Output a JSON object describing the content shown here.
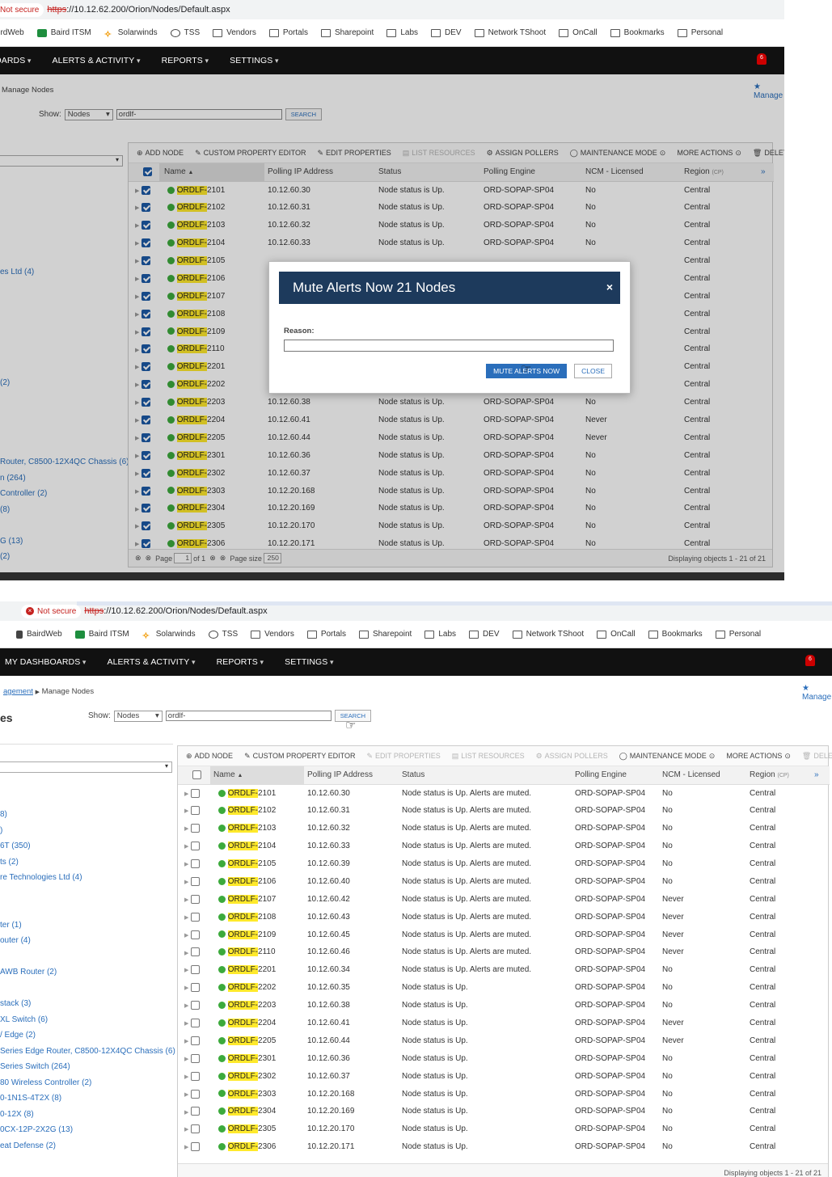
{
  "browser": {
    "not_secure_label": "Not secure",
    "url_scheme": "https",
    "url_rest": "://10.12.62.200/Orion/Nodes/Default.aspx",
    "bookmarks": [
      "BairdWeb",
      "Baird ITSM",
      "Solarwinds",
      "TSS",
      "Vendors",
      "Portals",
      "Sharepoint",
      "Labs",
      "DEV",
      "Network TShoot",
      "OnCall",
      "Bookmarks",
      "Personal"
    ]
  },
  "nav": {
    "items": [
      "MY DASHBOARDS",
      "ALERTS & ACTIVITY",
      "REPORTS",
      "SETTINGS"
    ],
    "bell_count": "6"
  },
  "breadcrumb": {
    "parent": "agement",
    "current": "Manage Nodes"
  },
  "favorite_label": "Manage",
  "page_title_fragment": "es",
  "filter": {
    "show_label": "Show:",
    "show_value": "Nodes",
    "search_value": "ordlf-",
    "search_button": "SEARCH"
  },
  "toolbar": {
    "add_node": "ADD NODE",
    "custom_property_editor": "CUSTOM PROPERTY EDITOR",
    "edit_properties": "EDIT PROPERTIES",
    "list_resources": "LIST RESOURCES",
    "assign_pollers": "ASSIGN POLLERS",
    "maintenance_mode": "MAINTENANCE MODE",
    "more_actions": "MORE ACTIONS",
    "delete": "DELETE"
  },
  "columns": {
    "name": "Name",
    "ip": "Polling IP Address",
    "status": "Status",
    "engine": "Polling Engine",
    "ncm": "NCM - Licensed",
    "region": "Region",
    "region_suffix": "(CP)"
  },
  "name_prefix": "ORDLF-",
  "shot1": {
    "left_groups": [
      {
        "label": "es Ltd (4)"
      },
      {
        "label": "(2)"
      },
      {
        "label": "Router, C8500-12X4QC Chassis (6)"
      },
      {
        "label": "n (264)"
      },
      {
        "label": "Controller (2)"
      },
      {
        "label": "(8)"
      },
      {
        "label": "G (13)"
      },
      {
        "label": "(2)"
      }
    ],
    "rows": [
      {
        "num": "2101",
        "ip": "10.12.60.30",
        "status": "Node status is Up.",
        "engine": "ORD-SOPAP-SP04",
        "ncm": "No",
        "region": "Central"
      },
      {
        "num": "2102",
        "ip": "10.12.60.31",
        "status": "Node status is Up.",
        "engine": "ORD-SOPAP-SP04",
        "ncm": "No",
        "region": "Central"
      },
      {
        "num": "2103",
        "ip": "10.12.60.32",
        "status": "Node status is Up.",
        "engine": "ORD-SOPAP-SP04",
        "ncm": "No",
        "region": "Central"
      },
      {
        "num": "2104",
        "ip": "10.12.60.33",
        "status": "Node status is Up.",
        "engine": "ORD-SOPAP-SP04",
        "ncm": "No",
        "region": "Central"
      },
      {
        "num": "2105",
        "ip": "",
        "status": "",
        "engine": "",
        "ncm": "",
        "region": "Central"
      },
      {
        "num": "2106",
        "ip": "",
        "status": "",
        "engine": "",
        "ncm": "",
        "region": "Central"
      },
      {
        "num": "2107",
        "ip": "",
        "status": "",
        "engine": "",
        "ncm": "",
        "region": "Central"
      },
      {
        "num": "2108",
        "ip": "",
        "status": "",
        "engine": "",
        "ncm": "",
        "region": "Central"
      },
      {
        "num": "2109",
        "ip": "",
        "status": "",
        "engine": "",
        "ncm": "",
        "region": "Central"
      },
      {
        "num": "2110",
        "ip": "",
        "status": "",
        "engine": "",
        "ncm": "",
        "region": "Central"
      },
      {
        "num": "2201",
        "ip": "",
        "status": "",
        "engine": "",
        "ncm": "",
        "region": "Central"
      },
      {
        "num": "2202",
        "ip": "",
        "status": "",
        "engine": "",
        "ncm": "",
        "region": "Central"
      },
      {
        "num": "2203",
        "ip": "10.12.60.38",
        "status": "Node status is Up.",
        "engine": "ORD-SOPAP-SP04",
        "ncm": "No",
        "region": "Central"
      },
      {
        "num": "2204",
        "ip": "10.12.60.41",
        "status": "Node status is Up.",
        "engine": "ORD-SOPAP-SP04",
        "ncm": "Never",
        "region": "Central"
      },
      {
        "num": "2205",
        "ip": "10.12.60.44",
        "status": "Node status is Up.",
        "engine": "ORD-SOPAP-SP04",
        "ncm": "Never",
        "region": "Central"
      },
      {
        "num": "2301",
        "ip": "10.12.60.36",
        "status": "Node status is Up.",
        "engine": "ORD-SOPAP-SP04",
        "ncm": "No",
        "region": "Central"
      },
      {
        "num": "2302",
        "ip": "10.12.60.37",
        "status": "Node status is Up.",
        "engine": "ORD-SOPAP-SP04",
        "ncm": "No",
        "region": "Central"
      },
      {
        "num": "2303",
        "ip": "10.12.20.168",
        "status": "Node status is Up.",
        "engine": "ORD-SOPAP-SP04",
        "ncm": "No",
        "region": "Central"
      },
      {
        "num": "2304",
        "ip": "10.12.20.169",
        "status": "Node status is Up.",
        "engine": "ORD-SOPAP-SP04",
        "ncm": "No",
        "region": "Central"
      },
      {
        "num": "2305",
        "ip": "10.12.20.170",
        "status": "Node status is Up.",
        "engine": "ORD-SOPAP-SP04",
        "ncm": "No",
        "region": "Central"
      },
      {
        "num": "2306",
        "ip": "10.12.20.171",
        "status": "Node status is Up.",
        "engine": "ORD-SOPAP-SP04",
        "ncm": "No",
        "region": "Central"
      }
    ],
    "pager": {
      "page_label": "Page",
      "page_value": "1",
      "of_label": "of 1",
      "size_label": "Page size",
      "size_value": "250",
      "display_text": "Displaying objects 1 - 21 of 21"
    }
  },
  "dialog": {
    "title": "Mute Alerts Now 21 Nodes",
    "close_x": "×",
    "reason_label": "Reason:",
    "reason_value": "",
    "mute_button": "MUTE ALERTS NOW",
    "close_button": "CLOSE"
  },
  "shot2": {
    "left_groups": [
      {
        "label": "8)"
      },
      {
        "label": ")"
      },
      {
        "label": "6T (350)"
      },
      {
        "label": "ts (2)"
      },
      {
        "label": "re Technologies Ltd (4)"
      },
      {
        "label": "ter (1)"
      },
      {
        "label": "outer (4)"
      },
      {
        "label": "AWB Router (2)"
      },
      {
        "label": "stack (3)"
      },
      {
        "label": "XL Switch (6)"
      },
      {
        "label": "/ Edge (2)"
      },
      {
        "label": "Series Edge Router, C8500-12X4QC Chassis (6)"
      },
      {
        "label": "Series Switch (264)"
      },
      {
        "label": "80 Wireless Controller (2)"
      },
      {
        "label": "0-1N1S-4T2X (8)"
      },
      {
        "label": "0-12X (8)"
      },
      {
        "label": "0CX-12P-2X2G (13)"
      },
      {
        "label": "eat Defense (2)"
      }
    ],
    "rows": [
      {
        "num": "2101",
        "ip": "10.12.60.30",
        "status": "Node status is Up. Alerts are muted.",
        "engine": "ORD-SOPAP-SP04",
        "ncm": "No",
        "region": "Central"
      },
      {
        "num": "2102",
        "ip": "10.12.60.31",
        "status": "Node status is Up. Alerts are muted.",
        "engine": "ORD-SOPAP-SP04",
        "ncm": "No",
        "region": "Central"
      },
      {
        "num": "2103",
        "ip": "10.12.60.32",
        "status": "Node status is Up. Alerts are muted.",
        "engine": "ORD-SOPAP-SP04",
        "ncm": "No",
        "region": "Central"
      },
      {
        "num": "2104",
        "ip": "10.12.60.33",
        "status": "Node status is Up. Alerts are muted.",
        "engine": "ORD-SOPAP-SP04",
        "ncm": "No",
        "region": "Central"
      },
      {
        "num": "2105",
        "ip": "10.12.60.39",
        "status": "Node status is Up. Alerts are muted.",
        "engine": "ORD-SOPAP-SP04",
        "ncm": "No",
        "region": "Central"
      },
      {
        "num": "2106",
        "ip": "10.12.60.40",
        "status": "Node status is Up. Alerts are muted.",
        "engine": "ORD-SOPAP-SP04",
        "ncm": "No",
        "region": "Central"
      },
      {
        "num": "2107",
        "ip": "10.12.60.42",
        "status": "Node status is Up. Alerts are muted.",
        "engine": "ORD-SOPAP-SP04",
        "ncm": "Never",
        "region": "Central"
      },
      {
        "num": "2108",
        "ip": "10.12.60.43",
        "status": "Node status is Up. Alerts are muted.",
        "engine": "ORD-SOPAP-SP04",
        "ncm": "Never",
        "region": "Central"
      },
      {
        "num": "2109",
        "ip": "10.12.60.45",
        "status": "Node status is Up. Alerts are muted.",
        "engine": "ORD-SOPAP-SP04",
        "ncm": "Never",
        "region": "Central"
      },
      {
        "num": "2110",
        "ip": "10.12.60.46",
        "status": "Node status is Up. Alerts are muted.",
        "engine": "ORD-SOPAP-SP04",
        "ncm": "Never",
        "region": "Central"
      },
      {
        "num": "2201",
        "ip": "10.12.60.34",
        "status": "Node status is Up. Alerts are muted.",
        "engine": "ORD-SOPAP-SP04",
        "ncm": "No",
        "region": "Central"
      },
      {
        "num": "2202",
        "ip": "10.12.60.35",
        "status": "Node status is Up.",
        "engine": "ORD-SOPAP-SP04",
        "ncm": "No",
        "region": "Central"
      },
      {
        "num": "2203",
        "ip": "10.12.60.38",
        "status": "Node status is Up.",
        "engine": "ORD-SOPAP-SP04",
        "ncm": "No",
        "region": "Central"
      },
      {
        "num": "2204",
        "ip": "10.12.60.41",
        "status": "Node status is Up.",
        "engine": "ORD-SOPAP-SP04",
        "ncm": "Never",
        "region": "Central"
      },
      {
        "num": "2205",
        "ip": "10.12.60.44",
        "status": "Node status is Up.",
        "engine": "ORD-SOPAP-SP04",
        "ncm": "Never",
        "region": "Central"
      },
      {
        "num": "2301",
        "ip": "10.12.60.36",
        "status": "Node status is Up.",
        "engine": "ORD-SOPAP-SP04",
        "ncm": "No",
        "region": "Central"
      },
      {
        "num": "2302",
        "ip": "10.12.60.37",
        "status": "Node status is Up.",
        "engine": "ORD-SOPAP-SP04",
        "ncm": "No",
        "region": "Central"
      },
      {
        "num": "2303",
        "ip": "10.12.20.168",
        "status": "Node status is Up.",
        "engine": "ORD-SOPAP-SP04",
        "ncm": "No",
        "region": "Central"
      },
      {
        "num": "2304",
        "ip": "10.12.20.169",
        "status": "Node status is Up.",
        "engine": "ORD-SOPAP-SP04",
        "ncm": "No",
        "region": "Central"
      },
      {
        "num": "2305",
        "ip": "10.12.20.170",
        "status": "Node status is Up.",
        "engine": "ORD-SOPAP-SP04",
        "ncm": "No",
        "region": "Central"
      },
      {
        "num": "2306",
        "ip": "10.12.20.171",
        "status": "Node status is Up.",
        "engine": "ORD-SOPAP-SP04",
        "ncm": "No",
        "region": "Central"
      }
    ],
    "pager": {
      "display_text": "Displaying objects 1 - 21 of 21"
    }
  },
  "colors": {
    "nav_bg": "#111111",
    "dialog_header": "#1d3a5c",
    "accent": "#2a6ebb",
    "highlight": "#ffe92b",
    "status_up": "#3caa3c"
  }
}
